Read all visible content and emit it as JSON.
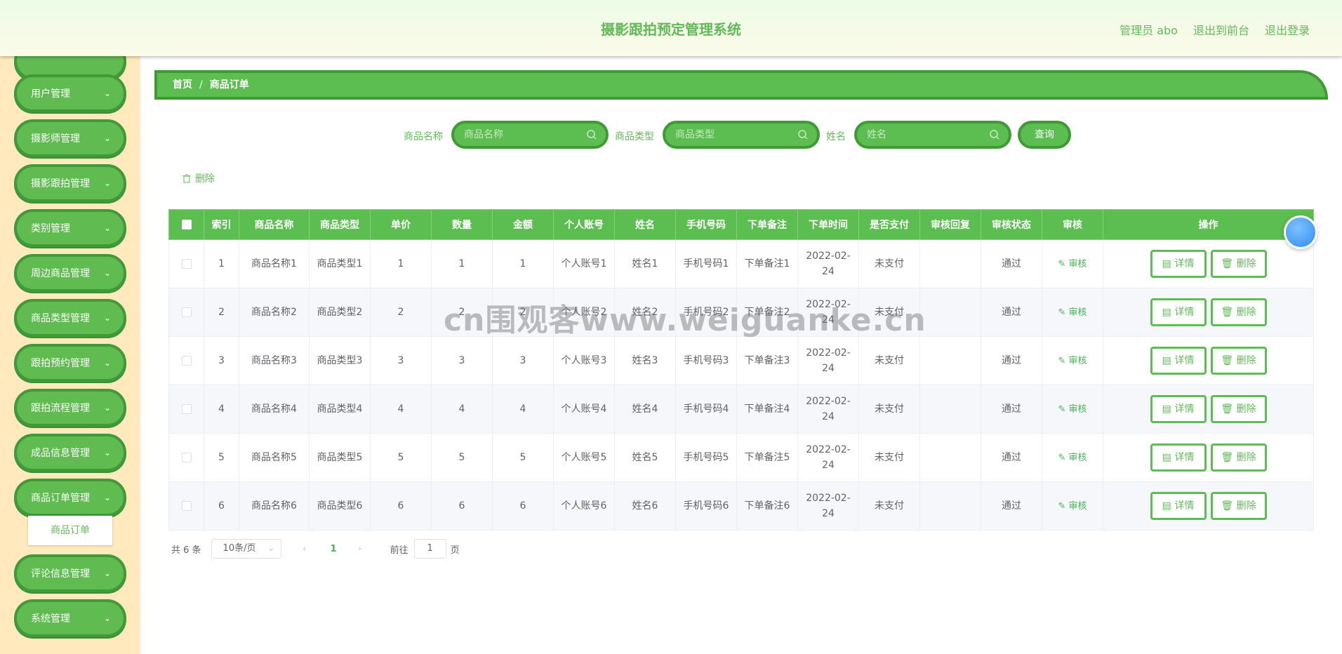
{
  "header": {
    "title": "摄影跟拍预定管理系统",
    "admin_label": "管理员 abo",
    "front_label": "退出到前台",
    "logout_label": "退出登录"
  },
  "sidebar": {
    "items": [
      {
        "label": "用户管理"
      },
      {
        "label": "摄影师管理"
      },
      {
        "label": "摄影跟拍管理"
      },
      {
        "label": "类别管理"
      },
      {
        "label": "周边商品管理"
      },
      {
        "label": "商品类型管理"
      },
      {
        "label": "跟拍预约管理"
      },
      {
        "label": "跟拍流程管理"
      },
      {
        "label": "成品信息管理"
      },
      {
        "label": "商品订单管理"
      },
      {
        "label": "评论信息管理"
      },
      {
        "label": "系统管理"
      }
    ],
    "sub_item": "商品订单"
  },
  "breadcrumb": {
    "home": "首页",
    "separator": "/",
    "current": "商品订单"
  },
  "search": {
    "name_label": "商品名称",
    "name_placeholder": "商品名称",
    "type_label": "商品类型",
    "type_placeholder": "商品类型",
    "person_label": "姓名",
    "person_placeholder": "姓名",
    "query_label": "查询"
  },
  "toolbar": {
    "delete_label": "删除"
  },
  "table": {
    "headers": [
      "索引",
      "商品名称",
      "商品类型",
      "单价",
      "数量",
      "金额",
      "个人账号",
      "姓名",
      "手机号码",
      "下单备注",
      "下单时间",
      "是否支付",
      "审核回复",
      "审核状态",
      "审核",
      "操作"
    ],
    "rows": [
      {
        "index": "1",
        "name": "商品名称1",
        "type": "商品类型1",
        "price": "1",
        "qty": "1",
        "amount": "1",
        "account": "个人账号1",
        "person": "姓名1",
        "phone": "手机号码1",
        "note": "下单备注1",
        "time": "2022-02-24",
        "paid": "未支付",
        "reply": "",
        "status": "通过"
      },
      {
        "index": "2",
        "name": "商品名称2",
        "type": "商品类型2",
        "price": "2",
        "qty": "2",
        "amount": "2",
        "account": "个人账号2",
        "person": "姓名2",
        "phone": "手机号码2",
        "note": "下单备注2",
        "time": "2022-02-24",
        "paid": "未支付",
        "reply": "",
        "status": "通过"
      },
      {
        "index": "3",
        "name": "商品名称3",
        "type": "商品类型3",
        "price": "3",
        "qty": "3",
        "amount": "3",
        "account": "个人账号3",
        "person": "姓名3",
        "phone": "手机号码3",
        "note": "下单备注3",
        "time": "2022-02-24",
        "paid": "未支付",
        "reply": "",
        "status": "通过"
      },
      {
        "index": "4",
        "name": "商品名称4",
        "type": "商品类型4",
        "price": "4",
        "qty": "4",
        "amount": "4",
        "account": "个人账号4",
        "person": "姓名4",
        "phone": "手机号码4",
        "note": "下单备注4",
        "time": "2022-02-24",
        "paid": "未支付",
        "reply": "",
        "status": "通过"
      },
      {
        "index": "5",
        "name": "商品名称5",
        "type": "商品类型5",
        "price": "5",
        "qty": "5",
        "amount": "5",
        "account": "个人账号5",
        "person": "姓名5",
        "phone": "手机号码5",
        "note": "下单备注5",
        "time": "2022-02-24",
        "paid": "未支付",
        "reply": "",
        "status": "通过"
      },
      {
        "index": "6",
        "name": "商品名称6",
        "type": "商品类型6",
        "price": "6",
        "qty": "6",
        "amount": "6",
        "account": "个人账号6",
        "person": "姓名6",
        "phone": "手机号码6",
        "note": "下单备注6",
        "time": "2022-02-24",
        "paid": "未支付",
        "reply": "",
        "status": "通过"
      }
    ],
    "audit_label": "审核",
    "detail_label": "详情",
    "delete_label": "删除"
  },
  "pagination": {
    "total_text": "共 6 条",
    "page_size": "10条/页",
    "current_page": "1",
    "goto_prefix": "前往",
    "goto_value": "1",
    "goto_suffix": "页"
  },
  "watermark": "cn围观客www.weiguanke.cn",
  "colors": {
    "primary": "#5cbd50",
    "border": "#3f9a35",
    "sidebar_bg": "#ffe9bd",
    "text_green": "#63b85a"
  }
}
